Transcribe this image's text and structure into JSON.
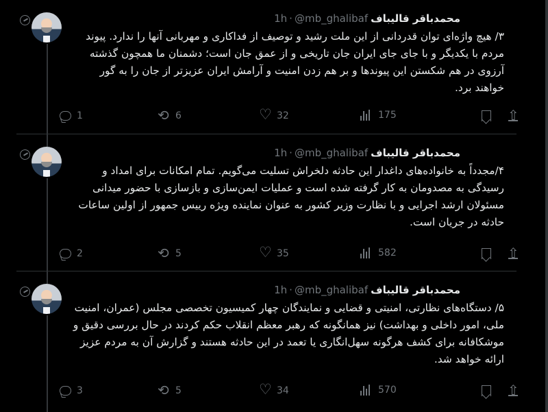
{
  "tweets": [
    {
      "name": "محمدباقر قالیباف",
      "handle": "@mb_ghalibaf",
      "time": "1h",
      "text": "۳/ هیچ واژه‌ای توان قدردانی از این ملت رشید و توصیف از فداکاری و مهربانی آنها را ندارد. پیوند مردم با یکدیگر و با جای جای ایران جان تاریخی و از عمق جان است؛ دشمنان ما همچون گذشته آرزوی در هم شکستن این پیوندها و بر هم زدن امنیت و آرامش ایران عزیزتر از جان را به گور خواهند برد.",
      "replies": "1",
      "retweets": "6",
      "likes": "32",
      "views": "175"
    },
    {
      "name": "محمدباقر قالیباف",
      "handle": "@mb_ghalibaf",
      "time": "1h",
      "text": "۴/مجدداً به خانواده‌های داغدار این حادثه دلخراش تسلیت می‌گویم. تمام امکانات برای امداد و رسیدگی به مصدومان به کار گرفته شده است و عملیات ایمن‌سازی و بازسازی با حضور میدانی مسئولان ارشد اجرایی و با نظارت وزیر کشور به عنوان نماینده ویژه رییس جمهور از اولین ساعات حادثه در جریان است.",
      "replies": "2",
      "retweets": "5",
      "likes": "35",
      "views": "582"
    },
    {
      "name": "محمدباقر قالیباف",
      "handle": "@mb_ghalibaf",
      "time": "1h",
      "text": "۵/ دستگاه‌های نظارتی، امنیتی و قضایی و نمایندگان چهار کمیسیون تخصصی مجلس (عمران، امنیت ملی، امور داخلی و بهداشت) نیز همانگونه که رهبر معظم انقلاب حکم کردند در حال بررسی دقیق و موشکافانه برای کشف هرگونه سهل‌انگاری یا تعمد در این حادثه هستند و گزارش آن به مردم عزیز ارائه خواهد شد.",
      "replies": "3",
      "retweets": "5",
      "likes": "34",
      "views": "570"
    }
  ],
  "icons": {
    "avatar": "avatar-icon",
    "more": "grok-icon",
    "reply": "reply-icon",
    "retweet": "retweet-icon",
    "like": "heart-icon",
    "views": "views-icon",
    "bookmark": "bookmark-icon",
    "share": "share-icon"
  },
  "colors": {
    "background": "#000000",
    "text": "#e7e9ea",
    "muted": "#71767b",
    "border": "#2f3336"
  }
}
